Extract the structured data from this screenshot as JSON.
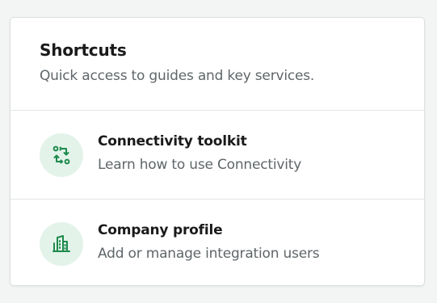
{
  "card": {
    "title": "Shortcuts",
    "subtitle": "Quick access to guides and key services."
  },
  "items": [
    {
      "title": "Connectivity toolkit",
      "description": "Learn how to use Connectivity",
      "icon": "connectivity-icon"
    },
    {
      "title": "Company profile",
      "description": "Add or manage integration users",
      "icon": "building-icon"
    }
  ],
  "colors": {
    "accent": "#1f8a4c",
    "icon_bg": "#e3f3ea"
  }
}
